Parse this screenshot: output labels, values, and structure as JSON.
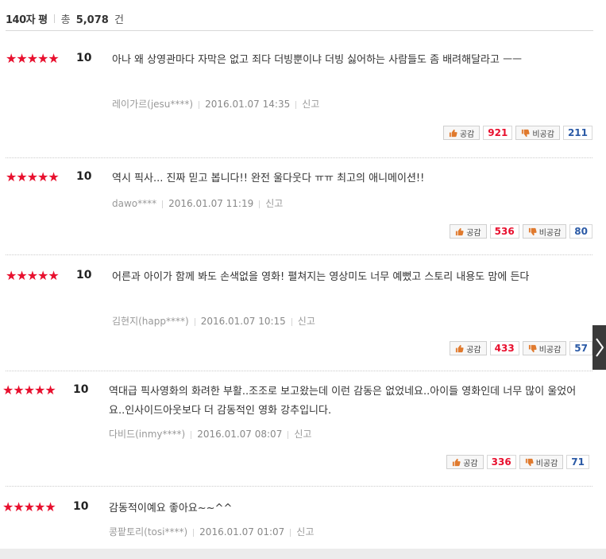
{
  "header": {
    "title": "140자 평",
    "total_prefix": "총",
    "total_count": "5,078",
    "total_suffix": "건"
  },
  "reviews": [
    {
      "stars": "★★★★★",
      "score": "10",
      "text": "아나 왜 상영관마다 자막은 없고 죄다 더빙뿐이냐 더빙 싫어하는 사람들도 좀 배려해달라고 ㅡㅡ",
      "author": "레이가르(jesu****)",
      "date": "2016.01.07 14:35",
      "report": "신고",
      "like_label": "공감",
      "likes": "921",
      "dislike_label": "비공감",
      "dislikes": "211"
    },
    {
      "stars": "★★★★★",
      "score": "10",
      "text": "역시 픽사... 진짜 믿고 봅니다!! 완전 울다웃다 ㅠㅠ 최고의 애니메이션!!",
      "author": "dawo****",
      "date": "2016.01.07 11:19",
      "report": "신고",
      "like_label": "공감",
      "likes": "536",
      "dislike_label": "비공감",
      "dislikes": "80"
    },
    {
      "stars": "★★★★★",
      "score": "10",
      "text": "어른과 아이가 함께 봐도 손색없을 영화! 펼쳐지는 영상미도 너무 예뻤고 스토리 내용도 맘에 든다",
      "author": "김현지(happ****)",
      "date": "2016.01.07 10:15",
      "report": "신고",
      "like_label": "공감",
      "likes": "433",
      "dislike_label": "비공감",
      "dislikes": "57"
    },
    {
      "stars": "★★★★★",
      "score": "10",
      "text": "역대급 픽사영화의 화려한 부활..조조로 보고왔는데 이런 감동은 없었네요..아이들 영화인데 너무 많이 울었어요..인사이드아웃보다 더 감동적인 영화 강추입니다.",
      "author": "다비드(inmy****)",
      "date": "2016.01.07 08:07",
      "report": "신고",
      "like_label": "공감",
      "likes": "336",
      "dislike_label": "비공감",
      "dislikes": "71"
    },
    {
      "stars": "★★★★★",
      "score": "10",
      "text": "감동적이예요 좋아요~~^^",
      "author": "콩팥토리(tosi****)",
      "date": "2016.01.07 01:07",
      "report": "신고"
    }
  ],
  "colors": {
    "star": "#e8102e",
    "like_count": "#e8102e",
    "dislike_count": "#2b5aa6"
  },
  "icons": {
    "like": "thumbs-up-icon",
    "dislike": "thumbs-down-icon",
    "next": "chevron-right-icon"
  }
}
